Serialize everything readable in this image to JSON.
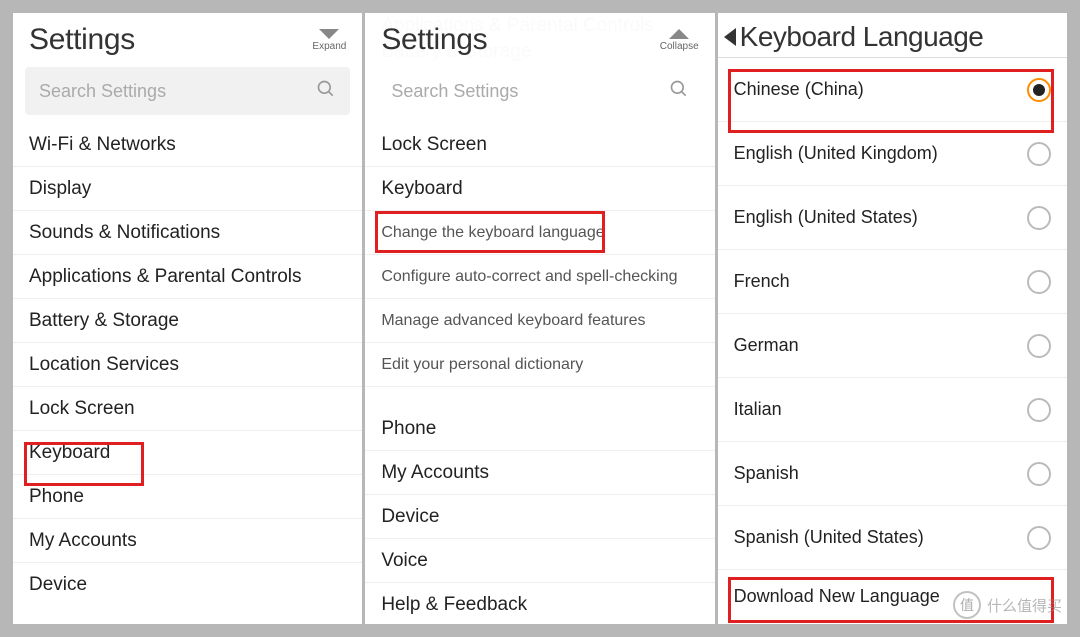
{
  "panel1": {
    "title": "Settings",
    "expand_label": "Expand",
    "search_placeholder": "Search Settings",
    "items": [
      "Wi-Fi & Networks",
      "Display",
      "Sounds & Notifications",
      "Applications & Parental Controls",
      "Battery & Storage",
      "Location Services",
      "Lock Screen",
      "Keyboard",
      "Phone",
      "My Accounts",
      "Device"
    ]
  },
  "panel2": {
    "title": "Settings",
    "collapse_label": "Collapse",
    "search_placeholder": "Search Settings",
    "ghost_rows": [
      "Applications & Parental Controls",
      "Battery & Storage"
    ],
    "groups": [
      {
        "header": "Lock Screen",
        "subs": []
      },
      {
        "header": "Keyboard",
        "subs": [
          "Change the keyboard language",
          "Configure auto-correct and spell-checking",
          "Manage advanced keyboard features",
          "Edit your personal dictionary"
        ]
      },
      {
        "header": "Phone",
        "subs": []
      },
      {
        "header": "My Accounts",
        "subs": []
      },
      {
        "header": "Device",
        "subs": []
      },
      {
        "header": "Voice",
        "subs": []
      },
      {
        "header": "Help & Feedback",
        "subs": []
      }
    ]
  },
  "panel3": {
    "title": "Keyboard Language",
    "languages": [
      {
        "label": "Chinese (China)",
        "selected": true
      },
      {
        "label": "English (United Kingdom)",
        "selected": false
      },
      {
        "label": "English (United States)",
        "selected": false
      },
      {
        "label": "French",
        "selected": false
      },
      {
        "label": "German",
        "selected": false
      },
      {
        "label": "Italian",
        "selected": false
      },
      {
        "label": "Spanish",
        "selected": false
      },
      {
        "label": "Spanish (United States)",
        "selected": false
      }
    ],
    "download_label": "Download New Language"
  },
  "watermark": {
    "badge": "值",
    "text": "什么值得买"
  }
}
